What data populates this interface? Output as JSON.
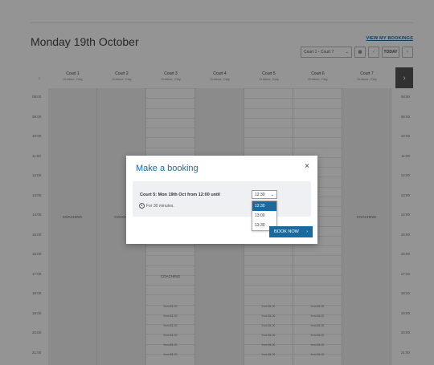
{
  "page": {
    "title": "Monday 19th October",
    "view_bookings": "VIEW MY BOOKINGS",
    "court_filter": "Court 1 - Court 7",
    "today_label": "TODAY"
  },
  "courts": [
    {
      "name": "Court 1",
      "surface": "Outdoor, Clay",
      "coaching": true,
      "text": "COACHING"
    },
    {
      "name": "Court 2",
      "surface": "Outdoor, Clay",
      "coaching": true,
      "text": "COACHI"
    },
    {
      "name": "Court 3",
      "surface": "Outdoor, Clay",
      "coaching": false,
      "text": "COACHING"
    },
    {
      "name": "Court 4",
      "surface": "Outdoor, Clay",
      "coaching": true,
      "text": ""
    },
    {
      "name": "Court 5",
      "surface": "Outdoor, Clay",
      "coaching": false,
      "text": ""
    },
    {
      "name": "Court 6",
      "surface": "Outdoor, Clay",
      "coaching": false,
      "text": ""
    },
    {
      "name": "Court 7",
      "surface": "Outdoor, Clay",
      "coaching": true,
      "text": "COACHING"
    }
  ],
  "hours": [
    "08:00",
    "09:00",
    "10:00",
    "11:00",
    "12:00",
    "13:00",
    "14:00",
    "15:00",
    "16:00",
    "17:00",
    "18:00",
    "19:00",
    "20:00",
    "21:00"
  ],
  "price_label": "from $4.00",
  "modal": {
    "title": "Make a booking",
    "close": "×",
    "booking_text": "Court 5: Mon 19th Oct from 12:00 until",
    "duration_text": "For 30 minutes.",
    "selected_time": "12:30",
    "options": [
      "12:30",
      "13:00",
      "13:30"
    ],
    "book_label": "BOOK NOW"
  },
  "colors": {
    "accent": "#1a6aa0"
  }
}
